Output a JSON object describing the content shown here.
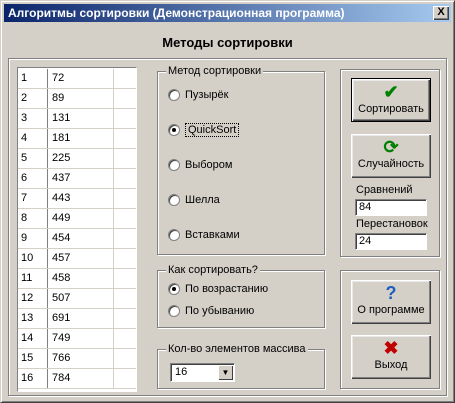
{
  "window": {
    "title": "Алгоритмы сортировки (Демонстрационная программа)",
    "close_label": "X"
  },
  "heading": "Методы сортировки",
  "array": [
    {
      "idx": "1",
      "val": "72"
    },
    {
      "idx": "2",
      "val": "89"
    },
    {
      "idx": "3",
      "val": "131"
    },
    {
      "idx": "4",
      "val": "181"
    },
    {
      "idx": "5",
      "val": "225"
    },
    {
      "idx": "6",
      "val": "437"
    },
    {
      "idx": "7",
      "val": "443"
    },
    {
      "idx": "8",
      "val": "449"
    },
    {
      "idx": "9",
      "val": "454"
    },
    {
      "idx": "10",
      "val": "457"
    },
    {
      "idx": "11",
      "val": "458"
    },
    {
      "idx": "12",
      "val": "507"
    },
    {
      "idx": "13",
      "val": "691"
    },
    {
      "idx": "14",
      "val": "749"
    },
    {
      "idx": "15",
      "val": "766"
    },
    {
      "idx": "16",
      "val": "784"
    }
  ],
  "method_group": {
    "label": "Метод сортировки",
    "options": [
      "Пузырёк",
      "QuickSort",
      "Выбором",
      "Шелла",
      "Вставками"
    ],
    "selected": "QuickSort"
  },
  "order_group": {
    "label": "Как сортировать?",
    "options": [
      "По возрастанию",
      "По убыванию"
    ],
    "selected": "По возрастанию"
  },
  "size_group": {
    "label": "Кол-во элементов массива",
    "value": "16"
  },
  "buttons": {
    "sort": "Сортировать",
    "random": "Случайность",
    "about": "О программе",
    "exit": "Выход"
  },
  "stats": {
    "comparisons_label": "Сравнений",
    "comparisons_value": "84",
    "swaps_label": "Перестановок",
    "swaps_value": "24"
  },
  "colors": {
    "check": "#008000",
    "refresh": "#008000",
    "question": "#1f5fbf",
    "exit_x": "#c00000"
  }
}
